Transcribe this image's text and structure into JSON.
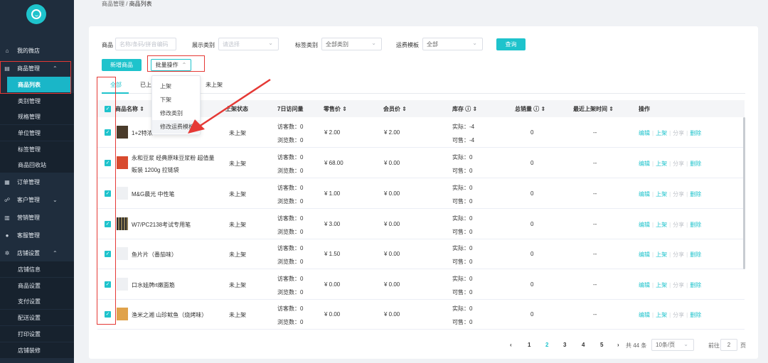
{
  "breadcrumb": {
    "parent": "商品管理",
    "sep": " / ",
    "current": "商品列表"
  },
  "sidebar": {
    "items": [
      {
        "label": "我的微店",
        "icon": "home-icon",
        "glyph": "⌂"
      },
      {
        "label": "商品管理",
        "icon": "goods-icon",
        "glyph": "▤",
        "chevron": "⌃"
      },
      {
        "label": "商品列表"
      },
      {
        "label": "类别管理"
      },
      {
        "label": "规格管理"
      },
      {
        "label": "单位管理"
      },
      {
        "label": "标签管理"
      },
      {
        "label": "商品回收站"
      },
      {
        "label": "订单管理",
        "icon": "order-icon",
        "glyph": "▦"
      },
      {
        "label": "客户管理",
        "icon": "customer-icon",
        "glyph": "☍",
        "chevron": "⌄"
      },
      {
        "label": "营销管理",
        "icon": "marketing-icon",
        "glyph": "▥"
      },
      {
        "label": "客服管理",
        "icon": "service-icon",
        "glyph": "●"
      },
      {
        "label": "店铺设置",
        "icon": "gear-icon",
        "glyph": "✲",
        "chevron": "⌃"
      },
      {
        "label": "店铺信息"
      },
      {
        "label": "商品设置"
      },
      {
        "label": "支付设置"
      },
      {
        "label": "配送设置"
      },
      {
        "label": "打印设置"
      },
      {
        "label": "店铺装修"
      }
    ]
  },
  "filters": {
    "goods_label": "商品",
    "goods_placeholder": "名称/条码/拼音编码",
    "display_label": "展示类别",
    "display_placeholder": "请选择",
    "tag_label": "标签类别",
    "tag_value": "全部类别",
    "freight_label": "运费模板",
    "freight_value": "全部",
    "query": "查询"
  },
  "actions": {
    "add": "新增商品",
    "batch": "批量操作",
    "batch_arrow": "⌃"
  },
  "tabs": [
    "全部",
    "已上",
    "未上架"
  ],
  "menu": [
    "上架",
    "下架",
    "修改类别",
    "修改运费模板"
  ],
  "table": {
    "headers": [
      "商品名称 ⇕",
      "上架状态",
      "7日访问量",
      "零售价 ⇕",
      "会员价 ⇕",
      "库存 ⓘ ⇕",
      "总销量 ⓘ ⇕",
      "最近上架时间 ⇕",
      "操作"
    ],
    "rows": [
      {
        "name1": "1+2特浓",
        "name2": "",
        "status": "未上架",
        "visits": "访客数：0",
        "views": "浏览数：0",
        "price": "¥ 2.00",
        "member": "¥ 2.00",
        "real": "实际：-4",
        "avail": "可售：-4",
        "sold": "0",
        "time": "--",
        "thumb": "dark"
      },
      {
        "name1": "永和豆浆 经典原味豆浆粉 超值量",
        "name2": "販装 1200g 拉链袋",
        "status": "未上架",
        "visits": "访客数：0",
        "views": "浏览数：0",
        "price": "¥ 68.00",
        "member": "¥ 0.00",
        "real": "实际：0",
        "avail": "可售：0",
        "sold": "0",
        "time": "--",
        "thumb": "red"
      },
      {
        "name1": "M&G晨光 中性笔",
        "name2": "",
        "status": "未上架",
        "visits": "访客数：0",
        "views": "浏览数：0",
        "price": "¥ 1.00",
        "member": "¥ 0.00",
        "real": "实际：0",
        "avail": "可售：0",
        "sold": "0",
        "time": "--",
        "thumb": "blank"
      },
      {
        "name1": "W7/PC2138考试专用笔",
        "name2": "",
        "status": "未上架",
        "visits": "访客数：0",
        "views": "浏览数：0",
        "price": "¥ 3.00",
        "member": "¥ 0.00",
        "real": "实际：0",
        "avail": "可售：0",
        "sold": "0",
        "time": "--",
        "thumb": "stripe"
      },
      {
        "name1": "鱼片片（番茄味）",
        "name2": "",
        "status": "未上架",
        "visits": "访客数：0",
        "views": "浏览数：0",
        "price": "¥ 1.50",
        "member": "¥ 0.00",
        "real": "实际：0",
        "avail": "可售：0",
        "sold": "0",
        "time": "--",
        "thumb": "blank"
      },
      {
        "name1": "口水娃牌rt嫩面筋",
        "name2": "",
        "status": "未上架",
        "visits": "访客数：0",
        "views": "浏览数：0",
        "price": "¥ 0.00",
        "member": "¥ 0.00",
        "real": "实际：0",
        "avail": "可售：0",
        "sold": "0",
        "time": "--",
        "thumb": "blank"
      },
      {
        "name1": "渔米之湘 山珍鱿鱼（烧烤味）",
        "name2": "",
        "status": "未上架",
        "visits": "访客数：0",
        "views": "浏览数：0",
        "price": "¥ 0.00",
        "member": "¥ 0.00",
        "real": "实际：0",
        "avail": "可售：0",
        "sold": "0",
        "time": "--",
        "thumb": "orange"
      }
    ],
    "ops": {
      "edit": "编辑",
      "shelf": "上架",
      "share": "分享",
      "del": "删除",
      "sep": "|"
    }
  },
  "pagination": {
    "prev": "‹",
    "pages": [
      "1",
      "2",
      "3",
      "4",
      "5"
    ],
    "current": "2",
    "next": "›",
    "total": "共 44 条",
    "size": "10条/页",
    "goto_label": "前往",
    "goto_value": "2",
    "goto_unit": "页"
  },
  "colors": {
    "accent": "#1ec3cc",
    "sidebar": "#1f2d3d",
    "annotation": "#e53935"
  }
}
